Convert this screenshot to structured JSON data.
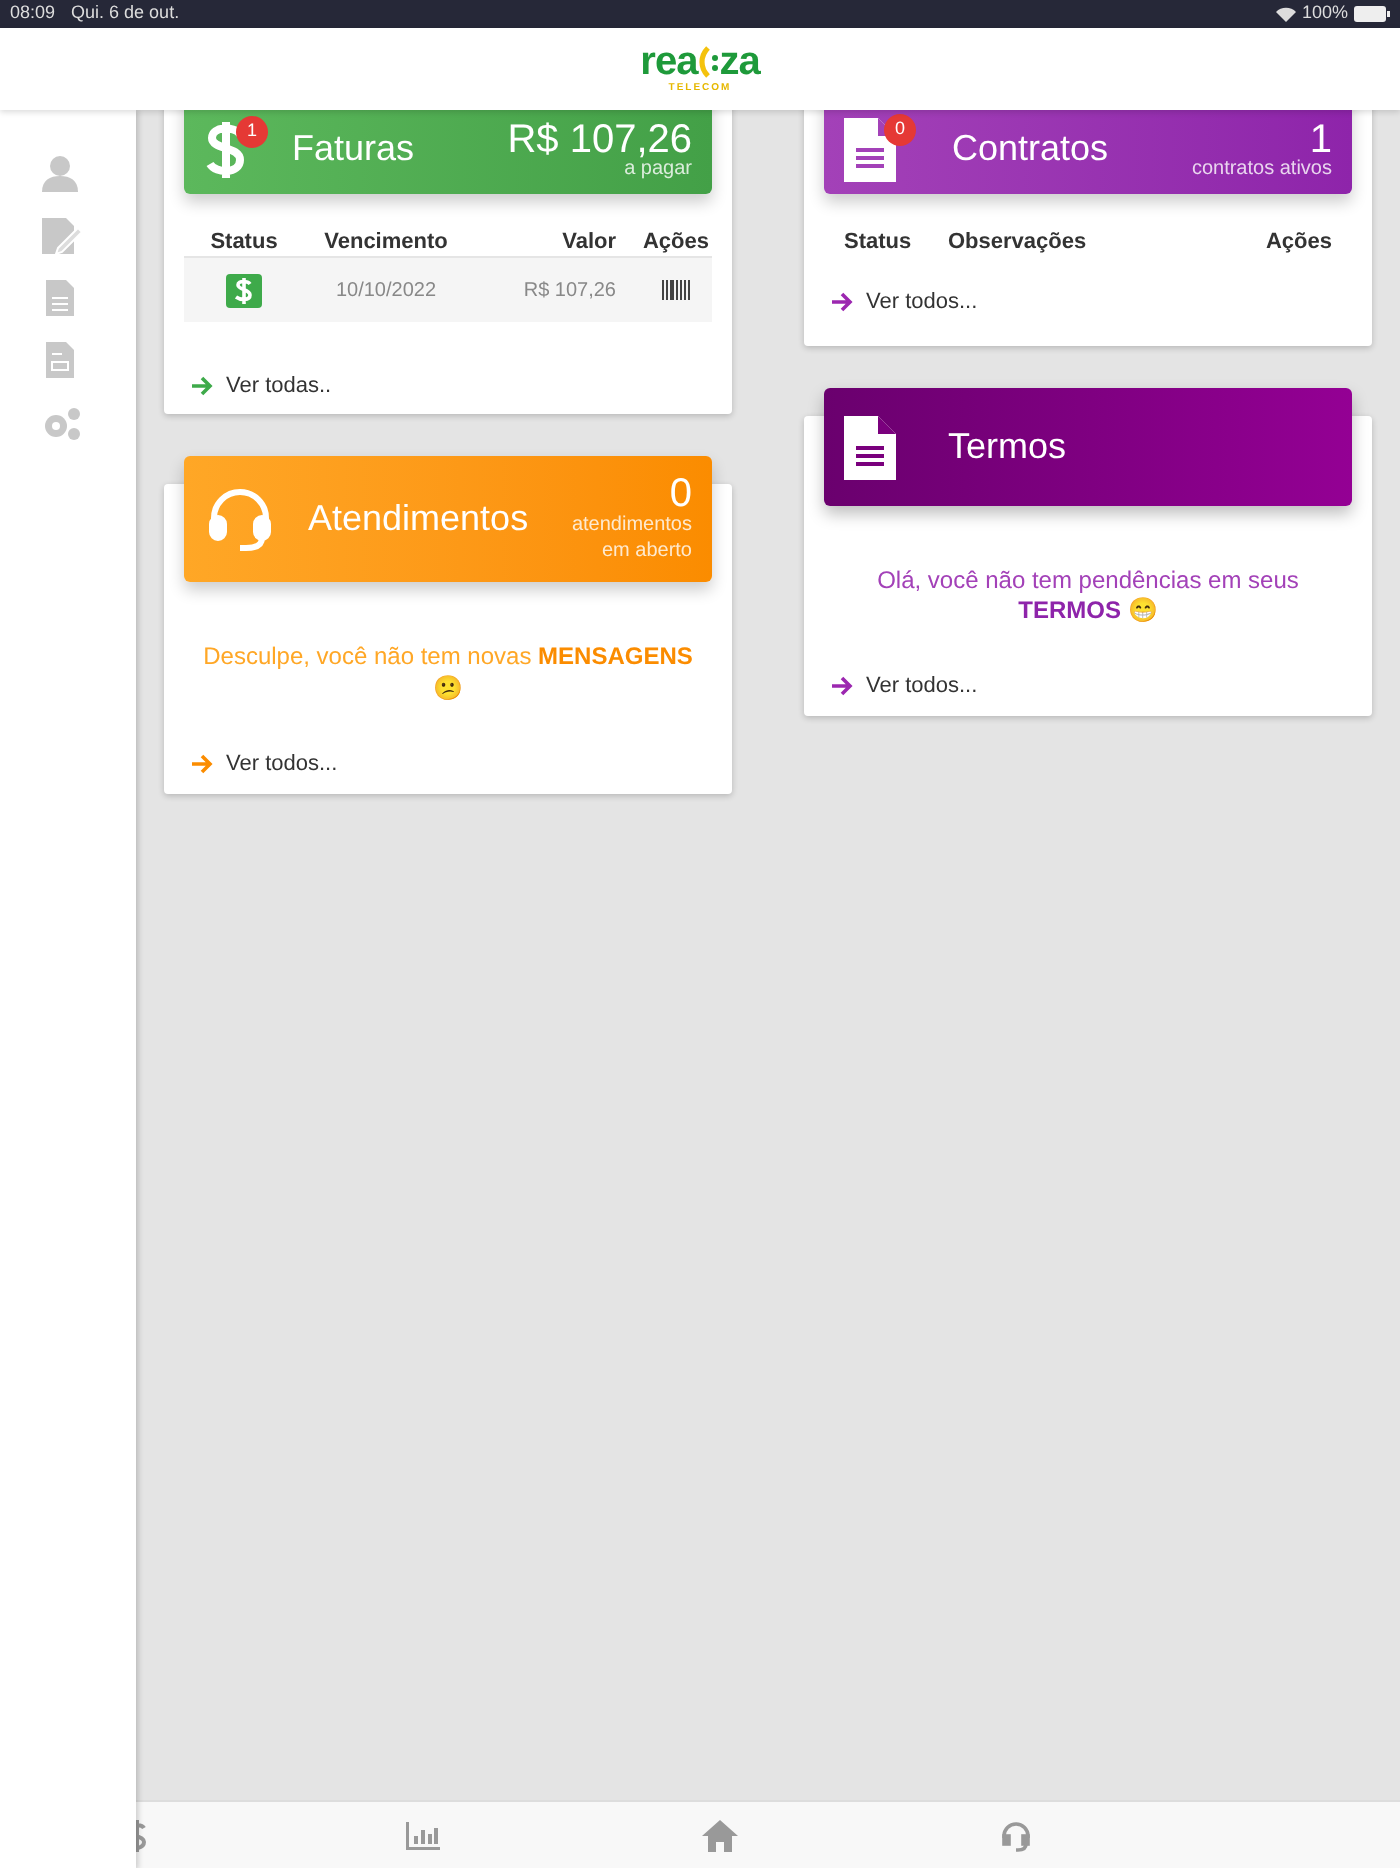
{
  "status_bar": {
    "time": "08:09",
    "date": "Qui. 6 de out.",
    "battery": "100%"
  },
  "logo": {
    "left": "rea",
    "right": "za",
    "tagline": "TELECOM"
  },
  "faturas": {
    "title": "Faturas",
    "badge": "1",
    "amount": "R$ 107,26",
    "amount_label": "a pagar",
    "columns": [
      "Status",
      "Vencimento",
      "Valor",
      "Ações"
    ],
    "rows": [
      {
        "vencimento": "10/10/2022",
        "valor": "R$ 107,26"
      }
    ],
    "link": "Ver todas.."
  },
  "contratos": {
    "title": "Contratos",
    "badge": "0",
    "count": "1",
    "count_label": "contratos ativos",
    "columns": [
      "Status",
      "Observações",
      "Ações"
    ],
    "link": "Ver todos..."
  },
  "atendimentos": {
    "title": "Atendimentos",
    "count": "0",
    "count_label": [
      "atendimentos",
      "em aberto"
    ],
    "message": "Desculpe, você não tem novas **MENSAGENS** 😕",
    "link": "Ver todos..."
  },
  "termos": {
    "title": "Termos",
    "message": "Olá, você não tem pendências em seus **TERMOS** 😁",
    "link": "Ver todos..."
  }
}
